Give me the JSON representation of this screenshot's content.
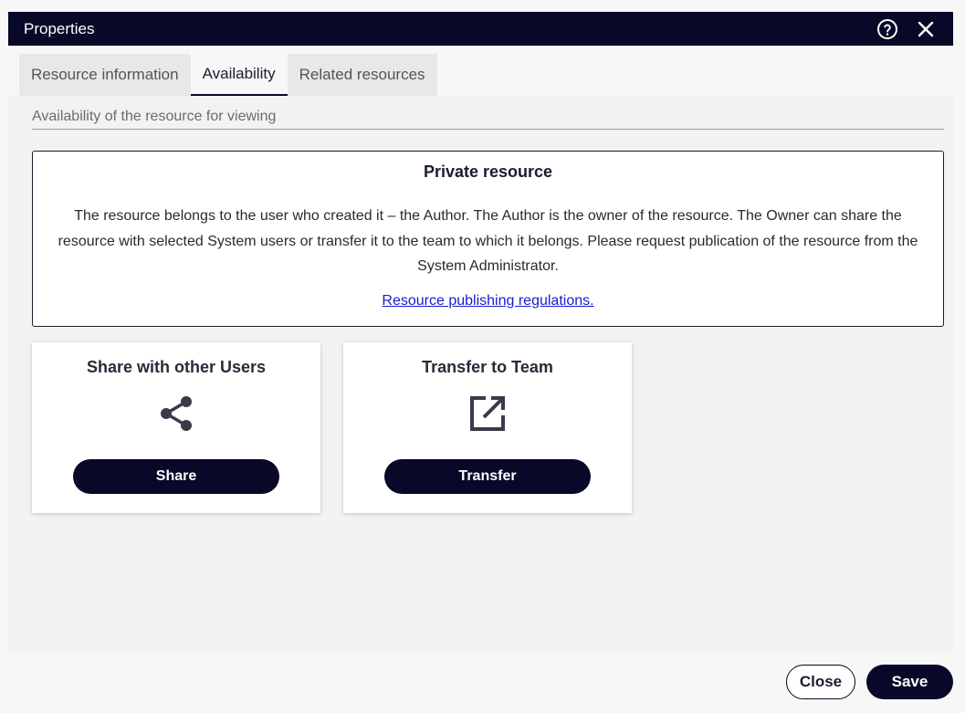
{
  "window": {
    "title": "Properties",
    "help_icon": "help-circle-icon",
    "close_icon": "close-icon"
  },
  "tabs": [
    {
      "label": "Resource information",
      "active": false
    },
    {
      "label": "Availability",
      "active": true
    },
    {
      "label": "Related resources",
      "active": false
    }
  ],
  "availability": {
    "section_label": "Availability of the resource for viewing",
    "info_title": "Private resource",
    "info_text": "The resource belongs to the user who created it – the Author. The Author is the owner of the resource. The Owner can share the resource with selected System users or transfer it to the team to which it belongs. Please request publication of the resource from the System Administrator.",
    "info_link": "Resource publishing regulations."
  },
  "cards": {
    "share": {
      "title": "Share with other Users",
      "icon": "share-icon",
      "button": "Share"
    },
    "transfer": {
      "title": "Transfer to Team",
      "icon": "external-link-icon",
      "button": "Transfer"
    }
  },
  "footer": {
    "close_label": "Close",
    "save_label": "Save"
  },
  "colors": {
    "primary": "#080828",
    "link": "#1a1ad0",
    "background": "#f2f2f2"
  }
}
